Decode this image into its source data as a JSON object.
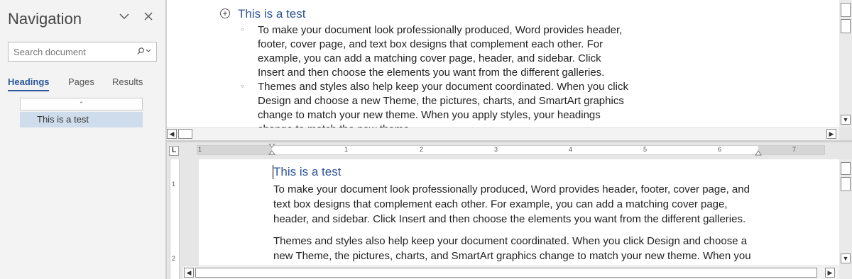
{
  "nav": {
    "title": "Navigation",
    "collapse_icon": "chevron-down-icon",
    "close_icon": "close-icon",
    "search_placeholder": "Search document",
    "search_icon": "search-icon",
    "tabs": [
      {
        "label": "Headings",
        "active": true
      },
      {
        "label": "Pages",
        "active": false
      },
      {
        "label": "Results",
        "active": false
      }
    ],
    "heading_item": "This is a test"
  },
  "top_pane": {
    "heading": "This is a test",
    "bullets": [
      "To make your document look professionally produced, Word provides header, footer, cover page, and text box designs that complement each other. For example, you can add a matching cover page, header, and sidebar. Click Insert and then choose the elements you want from the different galleries.",
      "Themes and styles also help keep your document coordinated. When you click Design and choose a new Theme, the pictures, charts, and SmartArt graphics change to match your new theme. When you apply styles, your headings change to match the new theme."
    ]
  },
  "ruler": {
    "numbers": [
      "1",
      "1",
      "2",
      "3",
      "4",
      "5",
      "6",
      "7"
    ],
    "vertical_numbers": [
      "1",
      "2"
    ],
    "tab_selector": "L"
  },
  "document": {
    "heading": "This is a test",
    "paragraphs": [
      "To make your document look professionally produced, Word provides header, footer, cover page, and text box designs that complement each other. For example, you can add a matching cover page, header, and sidebar. Click Insert and then choose the elements you want from the different galleries.",
      "Themes and styles also help keep your document coordinated. When you click Design and choose a new Theme, the pictures, charts, and SmartArt graphics change to match your new theme. When you apply"
    ]
  }
}
